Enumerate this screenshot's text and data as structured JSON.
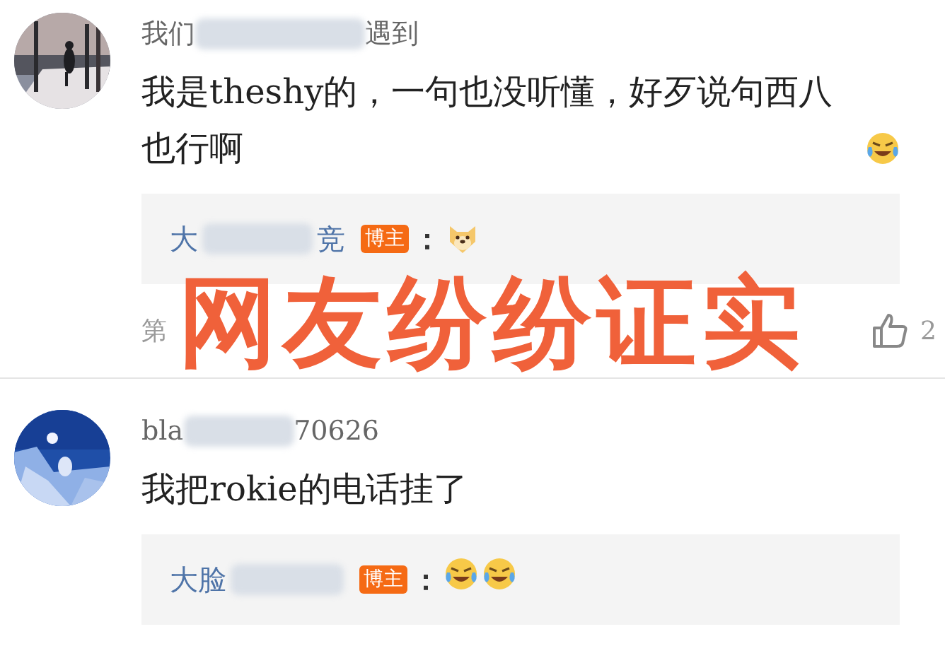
{
  "comments": [
    {
      "avatar": {
        "kind": "picture"
      },
      "name_start": "我们",
      "name_end": "遇到",
      "text": "我是theshy的，一句也没听懂，好歹说句西八也行啊",
      "emojis": [
        {
          "kind": "laughing"
        }
      ],
      "reply": {
        "name_start": "大",
        "name_end": "竞",
        "badge": "博主",
        "colon": "：",
        "emojis": [
          {
            "kind": "dog"
          }
        ]
      },
      "meta": {
        "floor": "第",
        "likes": "2"
      }
    },
    {
      "avatar": {
        "kind": "picture"
      },
      "name_start": "bla",
      "name_end": "70626",
      "text": "我把rokie的电话挂了",
      "reply": {
        "name_start": "大脸",
        "badge": "博主",
        "colon": "：",
        "emojis": [
          {
            "kind": "laughing"
          },
          {
            "kind": "laughing"
          }
        ]
      }
    }
  ],
  "overlay_caption": "网友纷纷证实"
}
